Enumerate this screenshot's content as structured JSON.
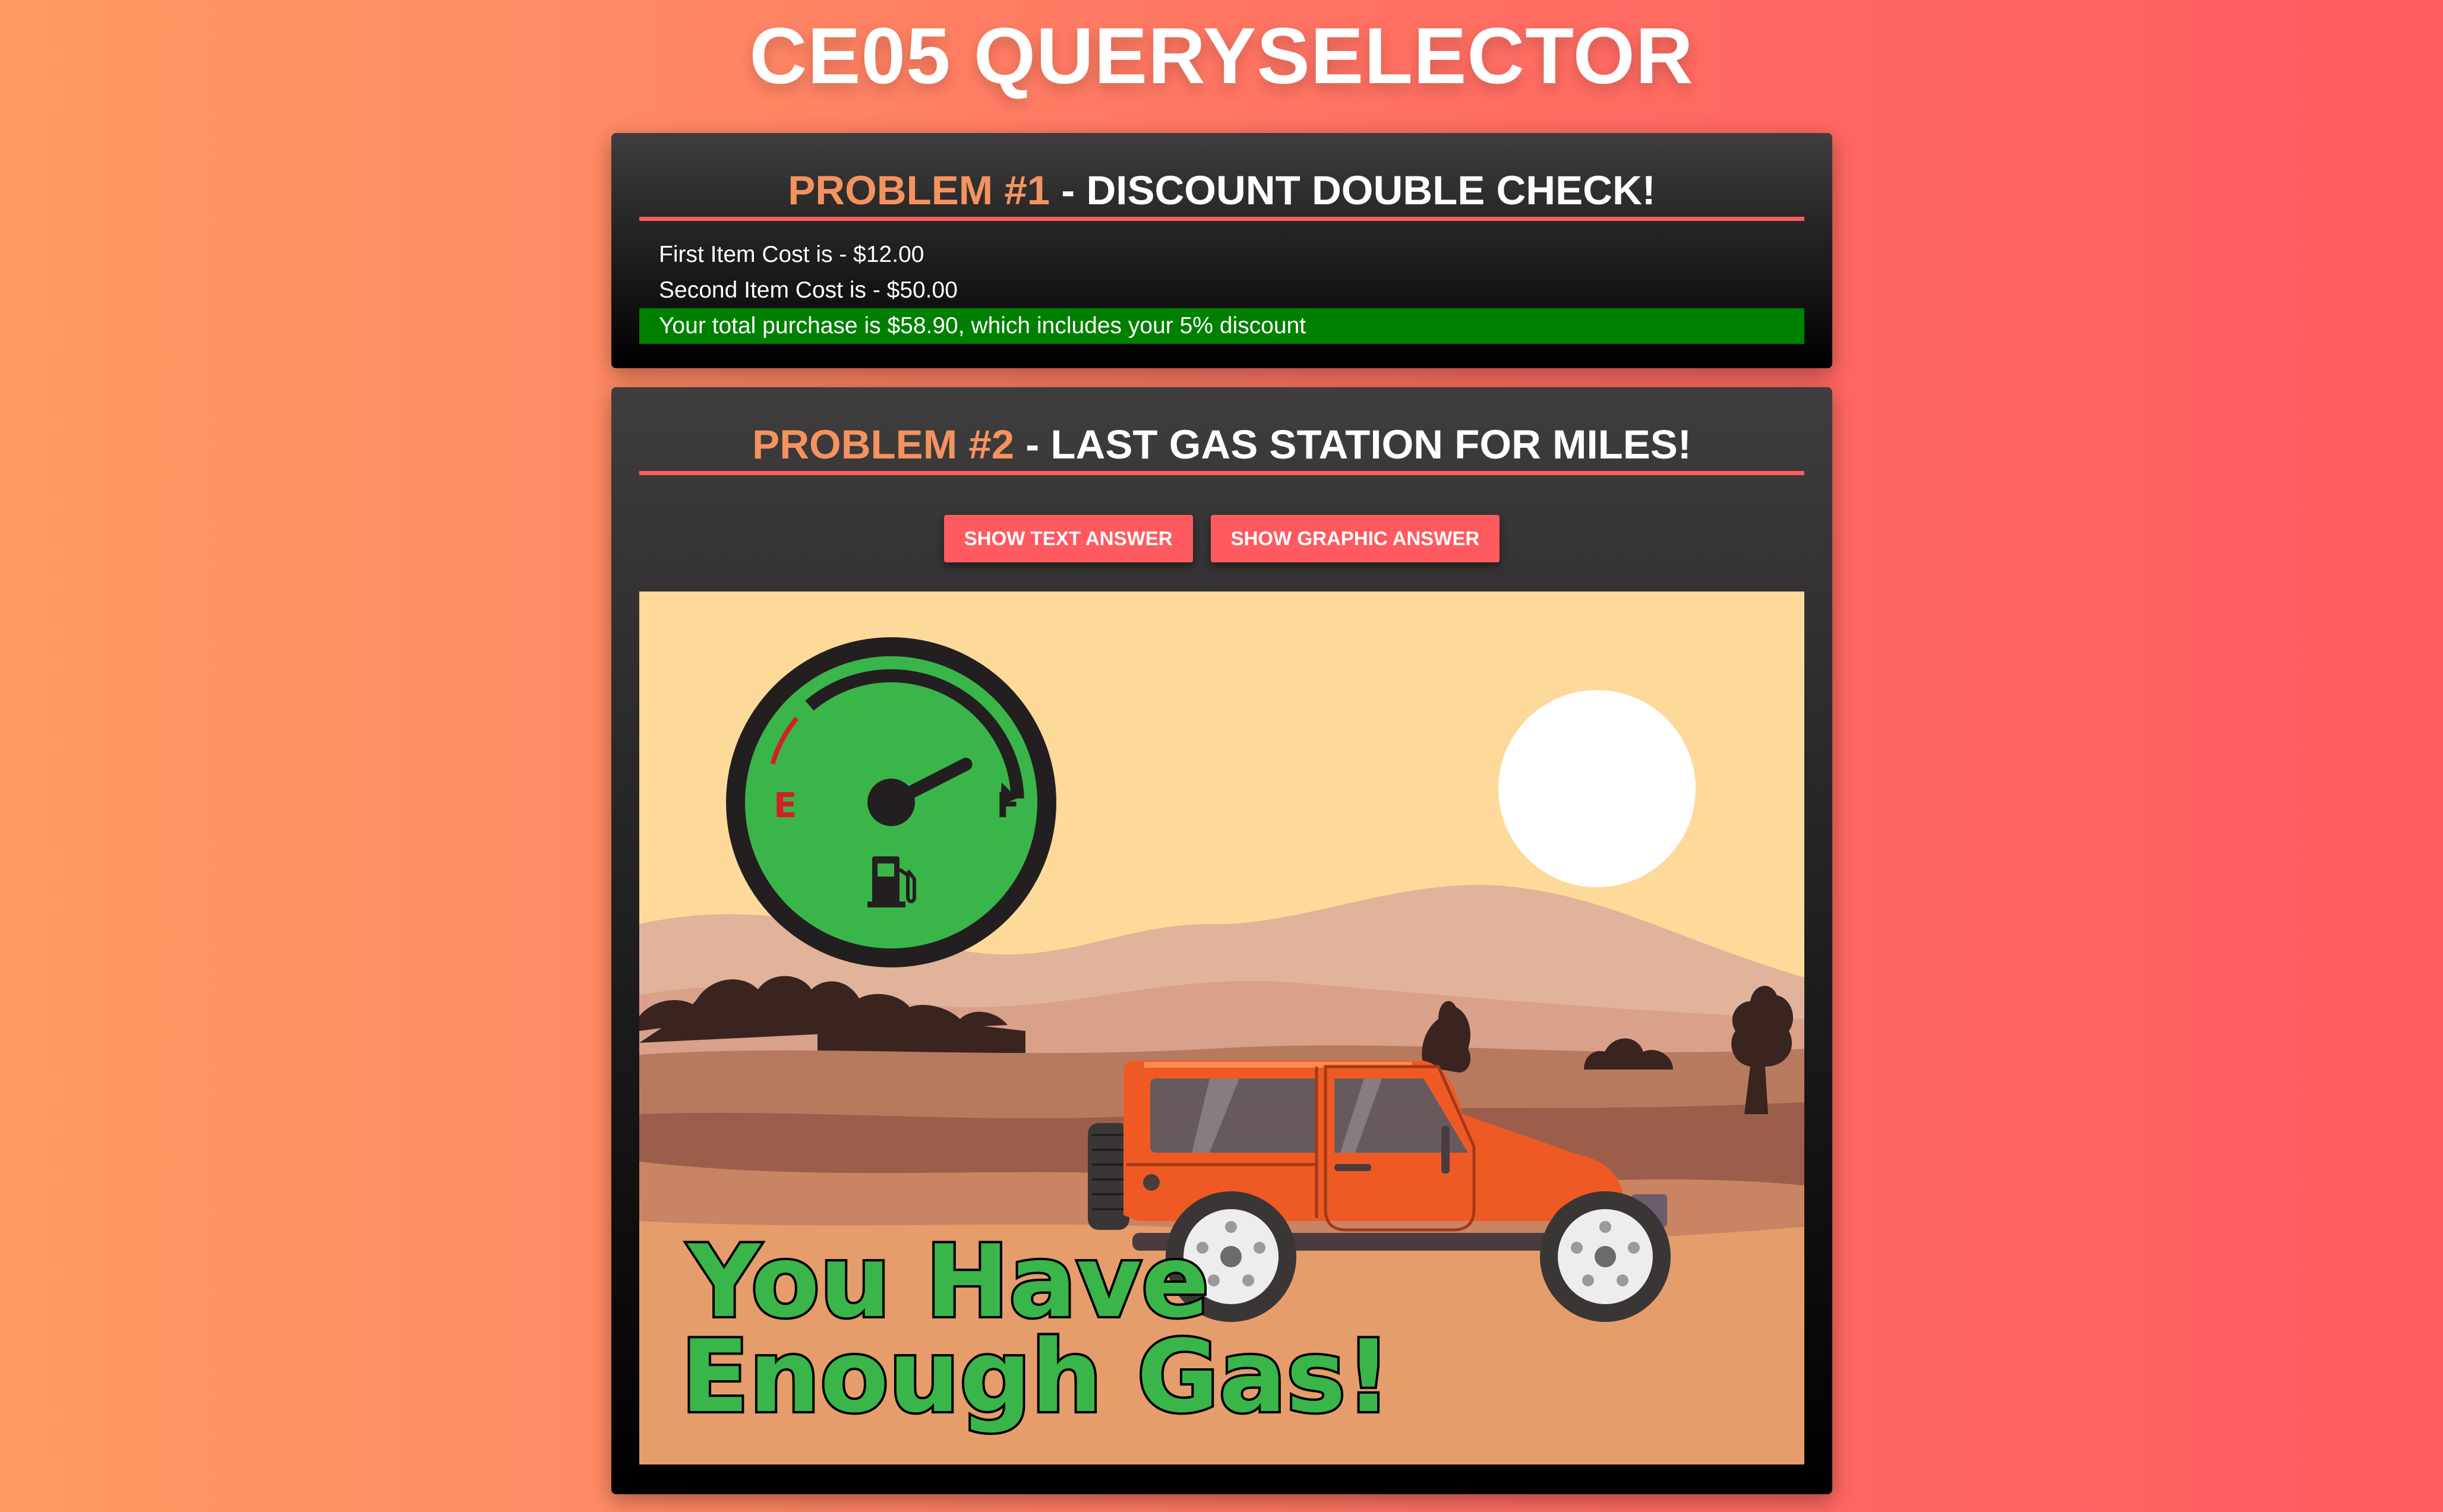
{
  "page": {
    "title": "CE05 QUERYSELECTOR"
  },
  "problem1": {
    "heading_num": "PROBLEM #1",
    "heading_text": " - DISCOUNT DOUBLE CHECK!",
    "first_item": "First Item Cost is - $12.00",
    "second_item": "Second Item Cost is - $50.00",
    "result": "Your total purchase is $58.90, which includes your 5% discount",
    "result_color": "#008000"
  },
  "problem2": {
    "heading_num": "PROBLEM #2",
    "heading_text": " - LAST GAS STATION FOR MILES!",
    "buttons": {
      "text_answer": "SHOW TEXT ANSWER",
      "graphic_answer": "SHOW GRAPHIC ANSWER"
    },
    "graphic": {
      "gauge": {
        "empty_label": "E",
        "full_label": "F",
        "fuel_level": 0.85
      },
      "message_line1": "You Have",
      "message_line2": "Enough Gas!",
      "message_color": "#3ab54a"
    }
  },
  "colors": {
    "accent": "#ff5a5f",
    "heading_highlight": "#f4935f"
  }
}
